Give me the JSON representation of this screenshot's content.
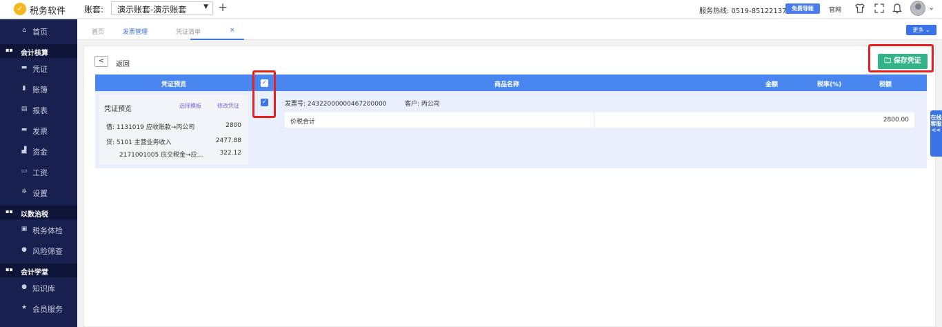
{
  "header": {
    "logo_glyph": "✓",
    "app_name": "税务软件",
    "account_label": "账套:",
    "account_value": "演示账套-演示账套",
    "add_glyph": "+",
    "hotline": "服务热线: 0519-85122137",
    "guide_button": "免费导账",
    "site_link": "官网",
    "icons": [
      "shirt-icon",
      "fullscreen-icon",
      "bell-icon",
      "avatar",
      "chevron-down-icon"
    ]
  },
  "sidebar": {
    "items": [
      {
        "label": "首页",
        "icon": "home-icon",
        "type": "item"
      },
      {
        "label": "会计核算",
        "icon": "grid-icon",
        "type": "section"
      },
      {
        "label": "凭证",
        "icon": "voucher-icon",
        "type": "item"
      },
      {
        "label": "账簿",
        "icon": "ledger-icon",
        "type": "item"
      },
      {
        "label": "报表",
        "icon": "report-icon",
        "type": "item"
      },
      {
        "label": "发票",
        "icon": "invoice-icon",
        "type": "item"
      },
      {
        "label": "资金",
        "icon": "fund-icon",
        "type": "item"
      },
      {
        "label": "工资",
        "icon": "salary-icon",
        "type": "item"
      },
      {
        "label": "设置",
        "icon": "gear-icon",
        "type": "item"
      },
      {
        "label": "以数治税",
        "icon": "grid-icon",
        "type": "section"
      },
      {
        "label": "税务体检",
        "icon": "checkup-icon",
        "type": "item"
      },
      {
        "label": "风险筛查",
        "icon": "risk-icon",
        "type": "item"
      },
      {
        "label": "会计学堂",
        "icon": "grid-icon",
        "type": "section"
      },
      {
        "label": "知识库",
        "icon": "location-icon",
        "type": "item"
      },
      {
        "label": "会员服务",
        "icon": "star-icon",
        "type": "item"
      }
    ]
  },
  "tabs": {
    "home": "首页",
    "invoice": "发票管理",
    "close": "×",
    "voucher_list": "凭证清单",
    "more": "更多 ⌄"
  },
  "page": {
    "back_glyph": "<",
    "back_label": "返回",
    "save_button": "🗀 保存凭证",
    "table_headers": {
      "voucher_preview": "凭证预览",
      "product_name": "商品名称",
      "amount": "金额",
      "tax_rate": "税率(%)",
      "tax_amount": "税额"
    },
    "voucher": {
      "title": "凭证预览",
      "select_template": "选择模板",
      "modify_voucher": "修改凭证",
      "lines": [
        {
          "text": "借: 1131019 应收账款→丙公司",
          "amount": "2800"
        },
        {
          "text": "贷: 5101 主营业务收入",
          "amount": "2477.88"
        },
        {
          "text": "2171001005 应交税金→应...",
          "amount": "322.12"
        }
      ]
    },
    "invoice_no": "发票号: 24322000000467200000",
    "customer": "客户: 丙公司",
    "total_label": "价税合计",
    "total_value": "2800.00",
    "checkbox_glyph": "✓"
  },
  "online_service": "在线客服<<",
  "colors": {
    "accent": "#3a72e8",
    "sidebar": "#18204f",
    "save": "#34b388",
    "highlight": "#e62020"
  }
}
